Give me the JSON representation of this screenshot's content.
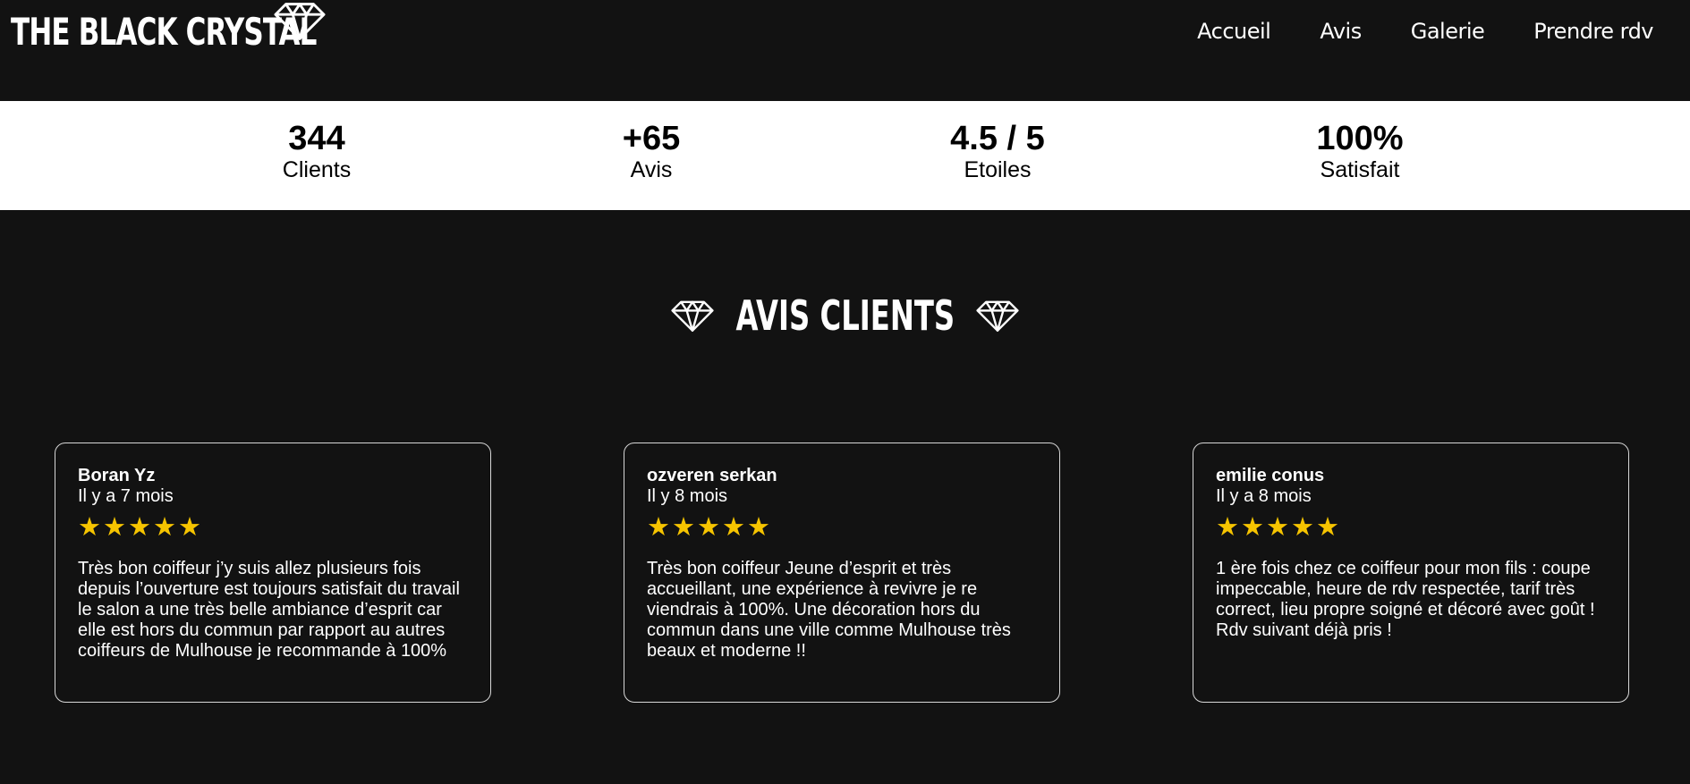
{
  "header": {
    "logo_text": "THE BLACK CRYSTAL",
    "nav": [
      "Accueil",
      "Avis",
      "Galerie",
      "Prendre rdv"
    ]
  },
  "stats": [
    {
      "value": "344",
      "label": "Clients"
    },
    {
      "value": "+65",
      "label": "Avis"
    },
    {
      "value": "4.5 / 5",
      "label": "Etoiles"
    },
    {
      "value": "100%",
      "label": "Satisfait"
    }
  ],
  "section": {
    "title": "AVIS CLIENTS"
  },
  "reviews": [
    {
      "name": "Boran Yz",
      "date": "Il y a 7 mois",
      "stars": 5,
      "text": "Très bon coiffeur j’y suis allez plusieurs fois depuis l’ouverture est toujours satisfait du travail le salon a une très belle ambiance d’esprit car elle est hors du commun par rapport au autres coiffeurs de Mulhouse je recommande à 100%"
    },
    {
      "name": "ozveren serkan",
      "date": "Il y 8 mois",
      "stars": 5,
      "text": "Très bon coiffeur Jeune d’esprit et très accueillant, une expérience à revivre je re viendrais à 100%. Une décoration hors du commun dans une ville comme Mulhouse très beaux et moderne !!"
    },
    {
      "name": "emilie conus",
      "date": "Il y a 8 mois",
      "stars": 5,
      "text": "1 ère fois chez ce coiffeur pour mon fils : coupe impeccable, heure de rdv respectée, tarif très correct, lieu propre soigné et décoré avec goût ! Rdv suivant déjà pris !"
    }
  ],
  "colors": {
    "background": "#121212",
    "stats_band": "#ffffff",
    "star": "#f6c400",
    "text": "#ffffff"
  },
  "icons": [
    "diamond-icon",
    "star-icon"
  ]
}
